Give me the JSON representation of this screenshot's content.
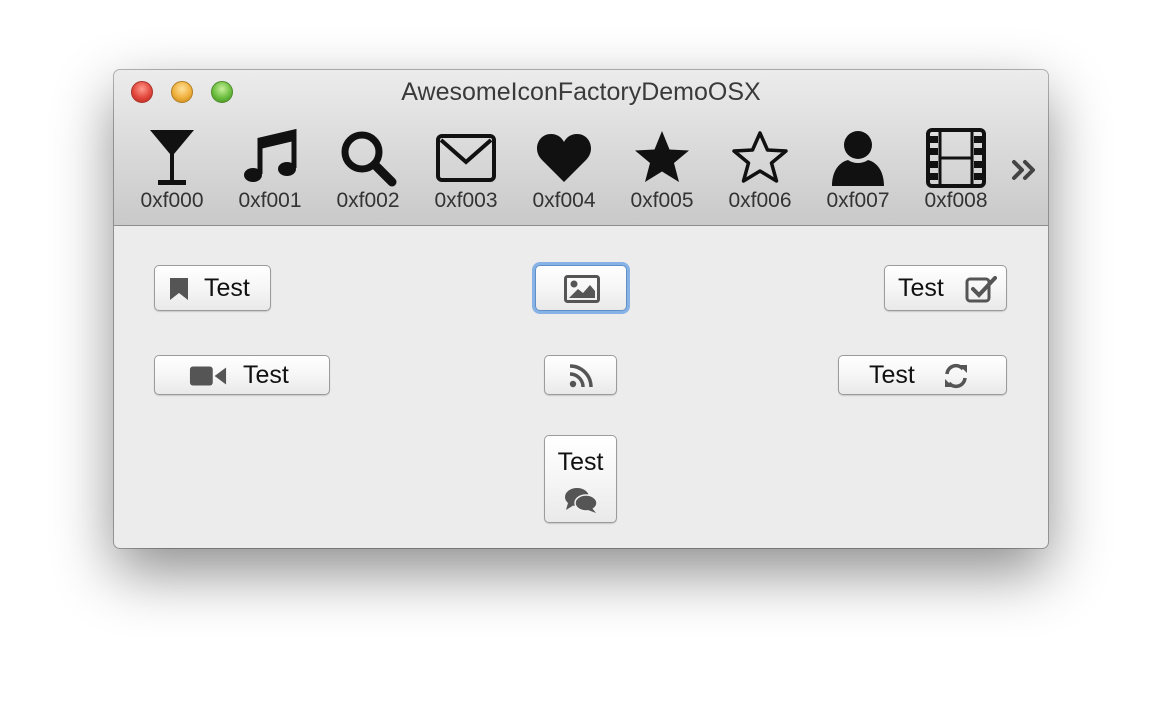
{
  "window": {
    "title": "AwesomeIconFactoryDemoOSX"
  },
  "toolbar": {
    "items": [
      {
        "icon": "glass-icon",
        "label": "0xf000"
      },
      {
        "icon": "music-icon",
        "label": "0xf001"
      },
      {
        "icon": "search-icon",
        "label": "0xf002"
      },
      {
        "icon": "envelope-icon",
        "label": "0xf003"
      },
      {
        "icon": "heart-icon",
        "label": "0xf004"
      },
      {
        "icon": "star-icon",
        "label": "0xf005"
      },
      {
        "icon": "star-outline-icon",
        "label": "0xf006"
      },
      {
        "icon": "user-icon",
        "label": "0xf007"
      },
      {
        "icon": "film-icon",
        "label": "0xf008"
      }
    ],
    "overflow_icon": "chevron-double-right-icon"
  },
  "buttons": {
    "bookmark": {
      "label": "Test",
      "icon": "bookmark-icon"
    },
    "picture": {
      "icon": "picture-icon"
    },
    "check": {
      "label": "Test",
      "icon": "check-square-icon"
    },
    "video": {
      "label": "Test",
      "icon": "video-camera-icon"
    },
    "rss": {
      "icon": "rss-icon"
    },
    "refresh": {
      "label": "Test",
      "icon": "refresh-icon"
    },
    "comments": {
      "label": "Test",
      "icon": "comments-icon"
    }
  },
  "colors": {
    "icon_dark": "#111111",
    "button_icon": "#555555",
    "focus_ring": "#86b2e6"
  }
}
